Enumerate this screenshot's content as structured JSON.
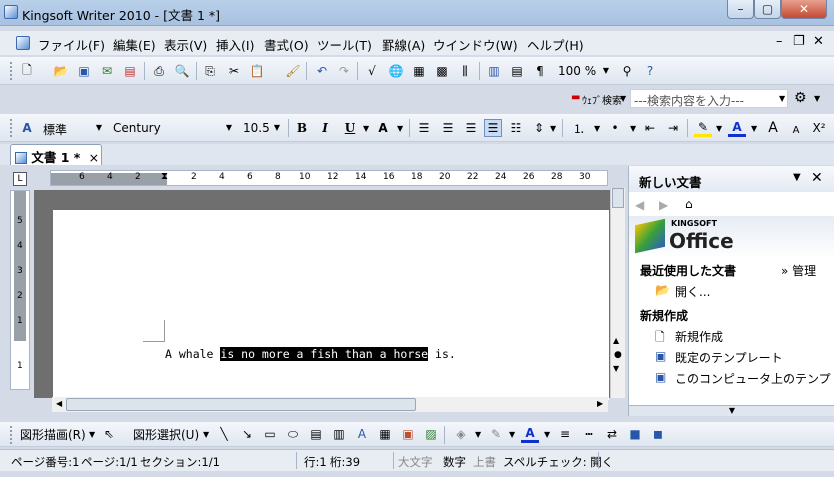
{
  "window": {
    "title": "Kingsoft Writer 2010 - [文書 1 *]",
    "min": "–",
    "max": "▢",
    "close": "✕"
  },
  "menu": [
    "ファイル(F)",
    "編集(E)",
    "表示(V)",
    "挿入(I)",
    "書式(O)",
    "ツール(T)",
    "罫線(A)",
    "ウインドウ(W)",
    "ヘルプ(H)"
  ],
  "mdi": {
    "min": "–",
    "restore": "❐",
    "close": "✕"
  },
  "toolbar": {
    "zoom": "100 %",
    "web_search": "ｳｪﾌﾞ検索",
    "search_placeholder": "---検索内容を入力---"
  },
  "format": {
    "style": "標準",
    "font": "Century",
    "size": "10.5",
    "bold": "B",
    "italic": "I",
    "underline": "U",
    "fontgrow": "A",
    "fontshrink": "A",
    "superscript": "X²"
  },
  "tab": {
    "label": "文書 1 *",
    "close": "×"
  },
  "ruler": {
    "numbers": [
      "6",
      "4",
      "2",
      "2",
      "4",
      "6",
      "8",
      "10",
      "12",
      "14",
      "16",
      "18",
      "20",
      "22",
      "24",
      "26",
      "28",
      "30"
    ],
    "vnumbers": [
      "5",
      "4",
      "3",
      "2",
      "1",
      "1"
    ],
    "corner": "L"
  },
  "document": {
    "text_before": "A whale ",
    "text_selected": "is no more a fish than a horse",
    "text_after": " is."
  },
  "panel": {
    "title": "新しい文書",
    "logo_top": "KINGSOFT",
    "logo_bottom": "Office",
    "recent_label": "最近使用した文書",
    "manage": "» 管理",
    "open": "開く...",
    "new_section": "新規作成",
    "new_item": "新規作成",
    "default_template": "既定のテンプレート",
    "computer_template": "このコンピュータ上のテンプレート..."
  },
  "drawbar": {
    "draw": "図形描画(R)",
    "select": "図形選択(U)"
  },
  "status": {
    "page_no": "ページ番号:1",
    "page": "ページ:1/1",
    "section": "セクション:1/1",
    "line": "行:1",
    "col": "桁:39",
    "caps": "大文字",
    "num": "数字",
    "ovr": "上書",
    "spell": "スペルチェック: 開く"
  }
}
